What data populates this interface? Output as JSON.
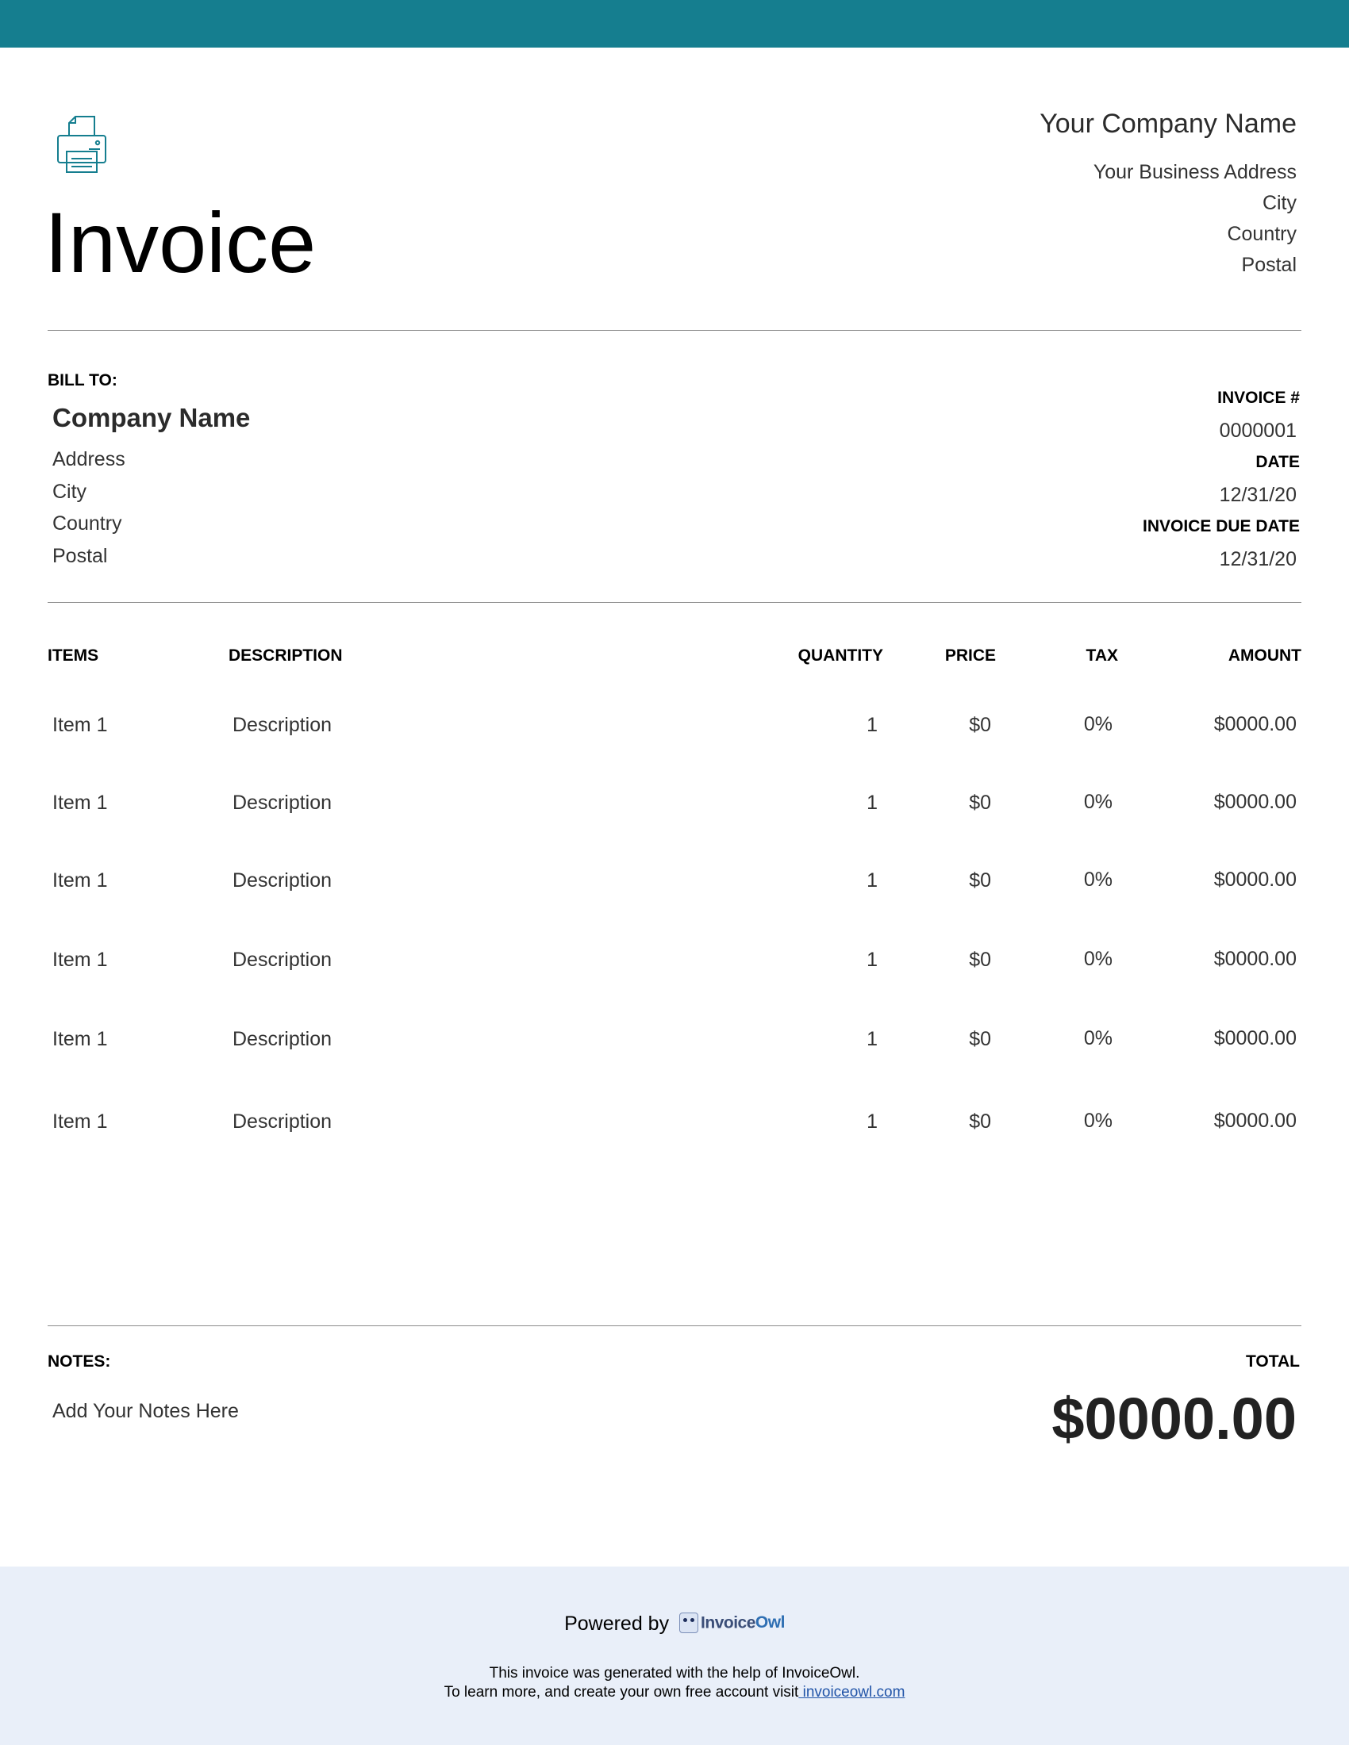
{
  "brand": {
    "accent": "#157e8f",
    "footer_bg": "#e9eff9"
  },
  "header": {
    "icon": "printer-icon",
    "title": "Invoice",
    "company_name": "Your Company Name",
    "address_lines": [
      "Your Business Address",
      "City",
      "Country",
      "Postal"
    ]
  },
  "bill_to": {
    "label": "BILL TO:",
    "name": "Company Name",
    "lines": [
      "Address",
      "City",
      "Country",
      "Postal"
    ]
  },
  "meta": {
    "invoice_label": "INVOICE #",
    "invoice_number": "0000001",
    "date_label": "DATE",
    "date": "12/31/20",
    "due_label": "INVOICE DUE DATE",
    "due_date": "12/31/20"
  },
  "table": {
    "headers": {
      "items": "ITEMS",
      "description": "DESCRIPTION",
      "quantity": "QUANTITY",
      "price": "PRICE",
      "tax": "TAX",
      "amount": "AMOUNT"
    },
    "rows": [
      {
        "item": "Item 1",
        "description": "Description",
        "quantity": "1",
        "price": "$0",
        "tax": "0%",
        "amount": "$0000.00"
      },
      {
        "item": "Item 1",
        "description": "Description",
        "quantity": "1",
        "price": "$0",
        "tax": "0%",
        "amount": "$0000.00"
      },
      {
        "item": "Item 1",
        "description": "Description",
        "quantity": "1",
        "price": "$0",
        "tax": "0%",
        "amount": "$0000.00"
      },
      {
        "item": "Item 1",
        "description": "Description",
        "quantity": "1",
        "price": "$0",
        "tax": "0%",
        "amount": "$0000.00"
      },
      {
        "item": "Item 1",
        "description": "Description",
        "quantity": "1",
        "price": "$0",
        "tax": "0%",
        "amount": "$0000.00"
      },
      {
        "item": "Item 1",
        "description": "Description",
        "quantity": "1",
        "price": "$0",
        "tax": "0%",
        "amount": "$0000.00"
      }
    ]
  },
  "notes": {
    "label": "NOTES:",
    "text": "Add Your Notes Here"
  },
  "total": {
    "label": "TOTAL",
    "value": "$0000.00"
  },
  "footer": {
    "powered_by": "Powered by",
    "logo_text": "Invoice",
    "logo_text_accent": "Owl",
    "generated_line": "This invoice was generated with the help of InvoiceOwl.",
    "learn_more": "To learn more, and create your own free account visit",
    "link_text": " invoiceowl.com"
  }
}
